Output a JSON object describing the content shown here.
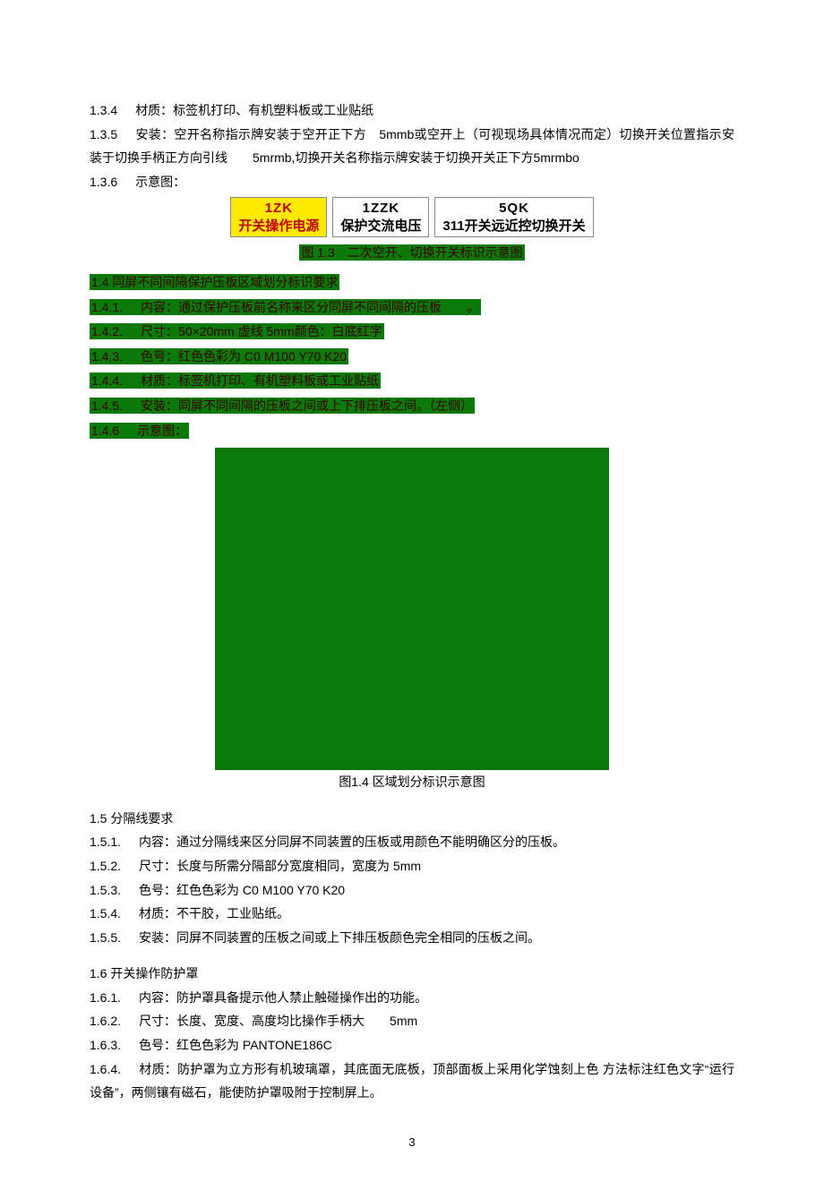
{
  "p134": {
    "num": "1.3.4",
    "text": "材质：标签机打印、有机塑料板或工业贴纸"
  },
  "p135": {
    "num": "1.3.5",
    "text": "安装：空开名称指示牌安装于空开正下方　5mmb或空开上（可视现场具体情况而定）切换开关位置指示安装于切换手柄正方向引线　　5mrmb,切换开关名称指示牌安装于切换开关正下方5mrmbo"
  },
  "p136": {
    "num": "1.3.6",
    "text": "示意图："
  },
  "labels": {
    "a": {
      "title": "1ZK",
      "sub": "开关操作电源"
    },
    "b": {
      "title": "1ZZK",
      "sub": "保护交流电压"
    },
    "c": {
      "title": "5QK",
      "sub": "311开关远近控切换开关"
    },
    "caption": "图 1.3　二次空开、切换开关标识示意图"
  },
  "hl14": {
    "text": "1.4  同屏不同间隔保护压板区域划分标识要求"
  },
  "hl141": {
    "num": "1.4.1.",
    "text": "内容：通过保护压板前名称来区分同屏不同间隔的压板　　。"
  },
  "hl142": {
    "num": "1.4.2.",
    "text": "尺寸：50×20mm  虚线 5mm颜色：白底红字"
  },
  "hl143": {
    "num": "1.4.3.",
    "text": "色号：红色色彩为 C0 M100 Y70 K20"
  },
  "hl144": {
    "num": "1.4.4.",
    "text": "材质：标签机打印、有机塑料板或工业贴纸"
  },
  "hl145": {
    "num": "1.4.5.",
    "text": "安装：同屏不同间隔的压板之间或上下排压板之间。（左侧）"
  },
  "hl146": {
    "num": "1.4.6",
    "text": "示意图："
  },
  "fig14caption": "图1.4 区域划分标识示意图",
  "s15": {
    "title": "1.5  分隔线要求"
  },
  "p151": {
    "num": "1.5.1.",
    "text": "内容：通过分隔线来区分同屏不同装置的压板或用颜色不能明确区分的压板。"
  },
  "p152": {
    "num": "1.5.2.",
    "text": "尺寸：长度与所需分隔部分宽度相同，宽度为 5mm"
  },
  "p153": {
    "num": "1.5.3.",
    "text": "色号：红色色彩为 C0 M100 Y70 K20"
  },
  "p154": {
    "num": "1.5.4.",
    "text": "材质：不干胶，工业贴纸。"
  },
  "p155": {
    "num": "1.5.5.",
    "text": "安装：同屏不同装置的压板之间或上下排压板颜色完全相同的压板之间。"
  },
  "s16": {
    "title": "1.6  开关操作防护罩"
  },
  "p161": {
    "num": "1.6.1.",
    "text": "内容：防护罩具备提示他人禁止触碰操作出的功能。"
  },
  "p162": {
    "num": "1.6.2.",
    "text": "尺寸：长度、宽度、高度均比操作手柄大　　5mm"
  },
  "p163": {
    "num": "1.6.3.",
    "text": "色号：红色色彩为 PANTONE186C"
  },
  "p164": {
    "num": "1.6.4.",
    "text": "材质：防护罩为立方形有机玻璃罩，其底面无底板，顶部面板上采用化学蚀刻上色 方法标注红色文字“运行设备”，两侧镶有磁石，能使防护罩吸附于控制屏上。"
  },
  "pageNumber": "3"
}
